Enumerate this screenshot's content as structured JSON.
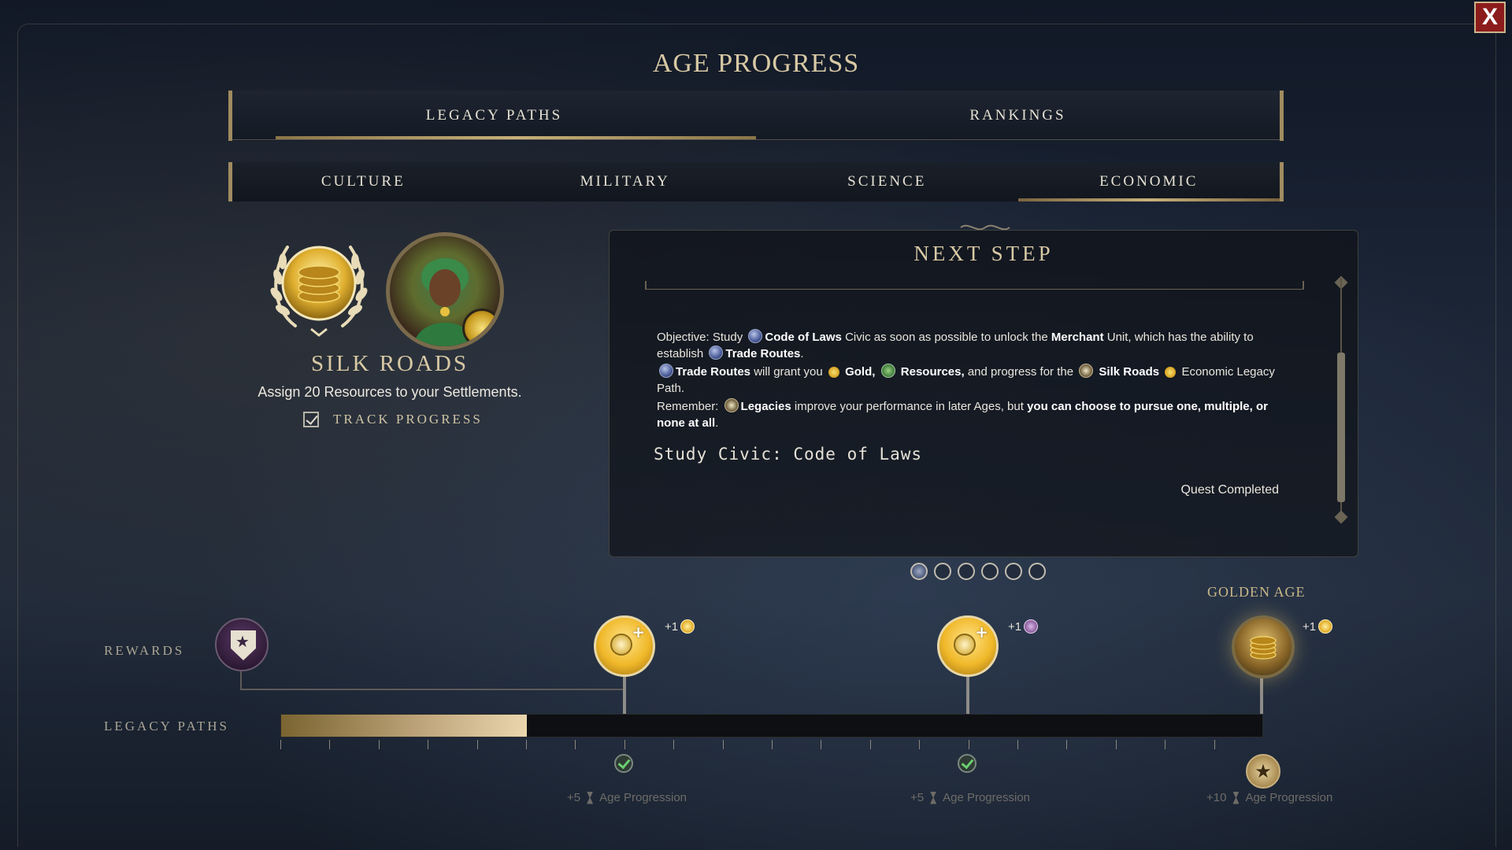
{
  "window": {
    "title": "AGE PROGRESS",
    "close_label": "X"
  },
  "main_tabs": [
    {
      "label": "LEGACY PATHS",
      "active": true
    },
    {
      "label": "RANKINGS",
      "active": false
    }
  ],
  "sub_tabs": [
    {
      "label": "CULTURE",
      "active": false
    },
    {
      "label": "MILITARY",
      "active": false
    },
    {
      "label": "SCIENCE",
      "active": false
    },
    {
      "label": "ECONOMIC",
      "active": true
    }
  ],
  "legacy": {
    "name": "SILK ROADS",
    "description": "Assign 20 Resources to your Settlements.",
    "track_label": "TRACK PROGRESS",
    "track_checked": true
  },
  "next_step": {
    "title": "NEXT STEP",
    "line1": {
      "t1": "Objective: Study",
      "b1": "Code of Laws",
      "t2": "Civic as soon as possible to unlock the",
      "b2": "Merchant",
      "t3": "Unit, which has the ability to establish",
      "b3": "Trade Routes",
      "t4": "."
    },
    "line2": {
      "b1": "Trade Routes",
      "t1": "will grant you",
      "b2": "Gold,",
      "b3": "Resources,",
      "t2": "and progress for the",
      "b4": "Silk Roads",
      "t3": "Economic Legacy Path."
    },
    "line3": {
      "t1": "Remember:",
      "b1": "Legacies",
      "t2": "improve your performance in later Ages, but",
      "b2": "you can choose to pursue one, multiple, or none at all",
      "t3": "."
    },
    "quest": "Study Civic: Code of Laws",
    "status": "Quest Completed",
    "icons": [
      "civic-icon",
      "gold-icon",
      "resources-icon",
      "legacy-icon"
    ]
  },
  "pager": {
    "pages": 6,
    "active_index": 0
  },
  "track": {
    "rewards_label": "REWARDS",
    "legacy_paths_label": "LEGACY PATHS",
    "golden_age_label": "GOLDEN AGE",
    "progress": 0.25,
    "ticks": 20,
    "milestones": [
      {
        "reward": "+1",
        "reward_icon": "gold",
        "points": "+5",
        "text": "Age Progression",
        "completed": true,
        "at": 0.35
      },
      {
        "reward": "+1",
        "reward_icon": "purple",
        "points": "+5",
        "text": "Age Progression",
        "completed": true,
        "at": 0.7
      },
      {
        "reward": "+1",
        "reward_icon": "gold",
        "points": "+10",
        "text": "Age Progression",
        "completed": false,
        "at": 1.0
      }
    ]
  },
  "colors": {
    "accent_gold": "#c8b07a",
    "title_text": "#d8c9a4",
    "check_green": "#6ad070"
  }
}
